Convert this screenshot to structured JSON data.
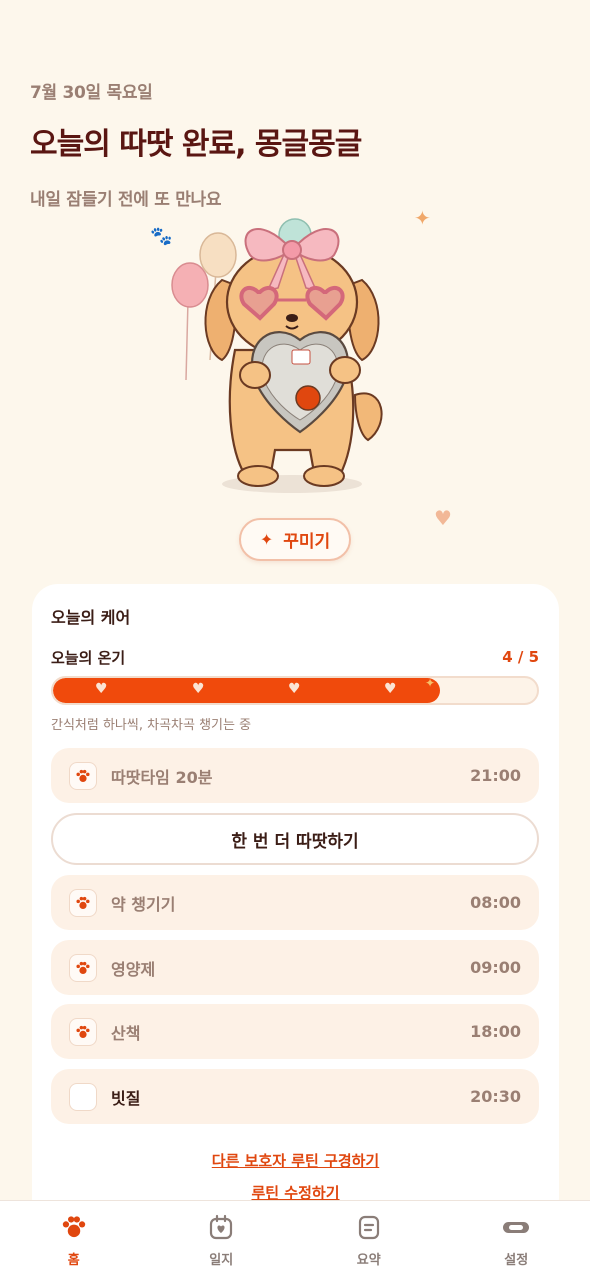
{
  "header": {
    "date": "7월 30일 목요일",
    "title": "오늘의 따땃 완료, 몽글몽글",
    "subtitle": "내일 잠들기 전에 또 만나요"
  },
  "decorate_button": {
    "icon": "sparkle-icon",
    "label": "꾸미기"
  },
  "care": {
    "title": "오늘의 케어",
    "warmth_label": "오늘의 온기",
    "warmth_count": "4 / 5",
    "warmth_progress": 0.8,
    "progress_caption": "간식처럼 하나씩, 차곡차곡 챙기는 중",
    "again_button": "한 번 더 따땃하기",
    "routines": [
      {
        "label": "따땃타임 20분",
        "time": "21:00",
        "done": true
      },
      {
        "label": "약 챙기기",
        "time": "08:00",
        "done": true
      },
      {
        "label": "영양제",
        "time": "09:00",
        "done": true
      },
      {
        "label": "산책",
        "time": "18:00",
        "done": true
      },
      {
        "label": "빗질",
        "time": "20:30",
        "done": false
      }
    ],
    "link_browse": "다른 보호자 루틴 구경하기",
    "link_edit": "루틴 수정하기"
  },
  "tabs": [
    {
      "label": "홈",
      "icon": "paw-icon",
      "active": true
    },
    {
      "label": "일지",
      "icon": "calendar-heart-icon",
      "active": false
    },
    {
      "label": "요약",
      "icon": "clipboard-icon",
      "active": false
    },
    {
      "label": "설정",
      "icon": "toggle-icon",
      "active": false
    }
  ],
  "colors": {
    "accent": "#e0470f",
    "background": "#fdf7ec",
    "title": "#5a1612",
    "muted": "#9a7f73"
  }
}
